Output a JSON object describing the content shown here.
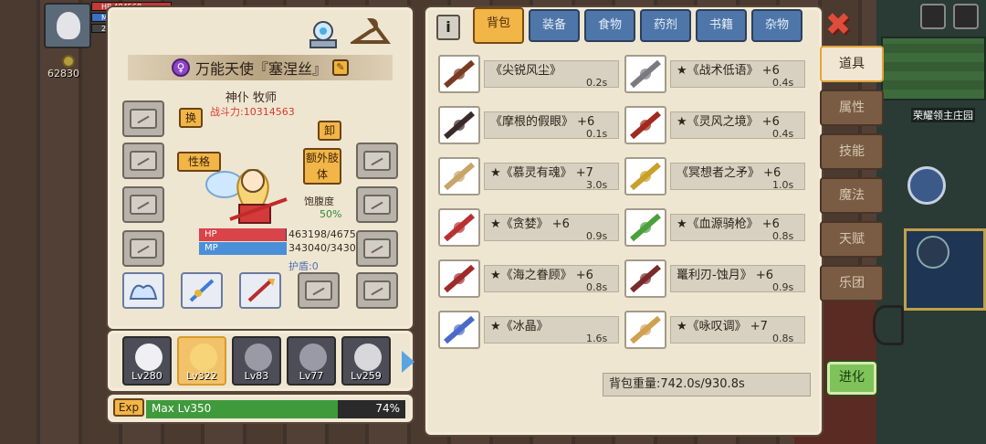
{
  "hud": {
    "hp_label": "HP",
    "hp_value": "484568",
    "mp_label": "MP",
    "level_short": "280",
    "coin_value": "62830"
  },
  "character": {
    "name": "万能天使『塞涅丝』",
    "class": "神仆 牧师",
    "power": "战斗力:10314563",
    "swap_label": "换",
    "unequip_label": "卸",
    "personality_label": "性格",
    "extra_limb_label": "额外肢体",
    "satiety_label": "饱腹度",
    "satiety_value": "50%",
    "hp_label": "HP",
    "mp_label": "MP",
    "hp_value": "463198/4675",
    "mp_value": "343040/3430",
    "shield": "护盾:0",
    "hp_ratio": 0.99,
    "mp_ratio": 1.0
  },
  "party": [
    {
      "lv": "Lv280"
    },
    {
      "lv": "Lv322"
    },
    {
      "lv": "Lv83"
    },
    {
      "lv": "Lv77"
    },
    {
      "lv": "Lv259"
    }
  ],
  "exp": {
    "label": "Exp",
    "text": "Max Lv350",
    "percent": "74%",
    "ratio": 0.74
  },
  "inventory": {
    "info_label": "i",
    "tabs": [
      "背包",
      "装备",
      "食物",
      "药剂",
      "书籍",
      "杂物"
    ],
    "active_tab": 0,
    "items_left": [
      {
        "name": "《尖锐风尘》",
        "weight": "0.2s"
      },
      {
        "name": "《摩根的假眼》 +6",
        "weight": "0.1s"
      },
      {
        "name": "★《慕灵有魂》 +7",
        "weight": "3.0s"
      },
      {
        "name": "★《贪婪》 +6",
        "weight": "0.9s"
      },
      {
        "name": "★《海之眷顾》 +6",
        "weight": "0.8s"
      },
      {
        "name": "★《冰晶》",
        "weight": "1.6s"
      }
    ],
    "items_right": [
      {
        "name": "★《战术低语》 +6",
        "weight": "0.4s"
      },
      {
        "name": "★《灵风之境》 +6",
        "weight": "0.4s"
      },
      {
        "name": "《冥想者之矛》 +6",
        "weight": "1.0s"
      },
      {
        "name": "★《血源骑枪》 +6",
        "weight": "0.8s"
      },
      {
        "name": "鼍利刃-蚀月》 +6",
        "weight": "0.9s"
      },
      {
        "name": "★《咏叹调》 +7",
        "weight": "0.8s"
      }
    ],
    "weight_total": "背包重量:742.0s/930.8s"
  },
  "side_tabs": [
    "道具",
    "属性",
    "技能",
    "魔法",
    "天赋",
    "乐团"
  ],
  "side_active": 0,
  "evolve_label": "进化",
  "map_label": "荣耀领主庄园",
  "colors": {
    "accent": "#f2b548",
    "tab_blue": "#4e76a8",
    "panel": "#efe6d1",
    "hp": "#d9434a",
    "mp": "#4a8fd8",
    "exp": "#3f9a3c"
  }
}
